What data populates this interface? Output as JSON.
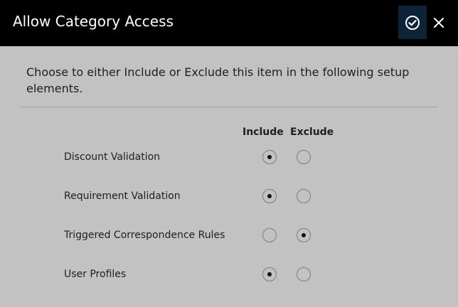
{
  "dialog": {
    "title": "Allow Category Access",
    "instructions": "Choose to either Include or Exclude this item in the following setup elements."
  },
  "columns": {
    "include": "Include",
    "exclude": "Exclude"
  },
  "rows": [
    {
      "label": "Discount Validation",
      "selected": "include"
    },
    {
      "label": "Requirement Validation",
      "selected": "include"
    },
    {
      "label": "Triggered Correspondence Rules",
      "selected": "exclude"
    },
    {
      "label": "User Profiles",
      "selected": "include"
    }
  ],
  "icons": {
    "confirm": "check-circle-icon",
    "close": "close-icon"
  },
  "colors": {
    "header_bg": "#000000",
    "confirm_bg": "#0e2338",
    "body_bg": "#c2c2c2"
  }
}
